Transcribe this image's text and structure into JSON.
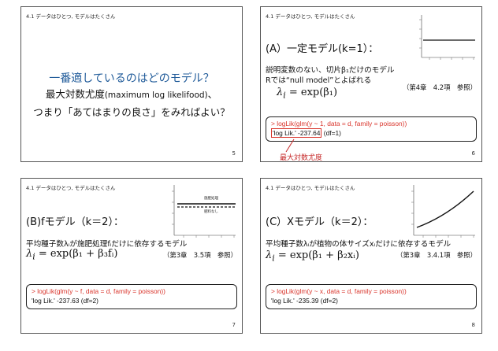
{
  "slides": [
    {
      "header": "4.1 データはひとつ, モデルはたくさん",
      "title": "一番適しているのはどのモデル？",
      "line1_main": "最大対数尤度",
      "line1_small": "(maximum log likelifood)",
      "line1_tail": "、",
      "line2": "つまり「あてはまりの良さ」をみればよい？",
      "page": "5"
    },
    {
      "header": "4.1 データはひとつ, モデルはたくさん",
      "model_title": "(A）一定モデル(k=1）：",
      "desc1": "説明変数のない、切片β₁だけのモデル",
      "desc2": "Rでは“null model”とよばれる",
      "ref": "（第4章　4.2項　参照）",
      "formula_lhs": "λ",
      "formula_sub": "i",
      "formula_rhs": " = exp(β₁)",
      "code": "> logLik(glm(y ~ 1, data = d, family = poisson))",
      "result_boxed": "'log Lik.' -237.64",
      "result_tail": " (df=1)",
      "annotation": "最大対数尤度",
      "page": "6"
    },
    {
      "header": "4.1 データはひとつ, モデルはたくさん",
      "model_title": "(B)fモデル（k＝2）：",
      "desc1": "平均種子数λᵢが施肥処理fᵢだけに依存するモデル",
      "ref": "（第3章　3.5項　参照）",
      "formula_lhs": "λ",
      "formula_sub": "i",
      "formula_rhs": " = exp(β₁ + β₃fᵢ)",
      "code": "> logLik(glm(y ~ f, data = d, family = poisson))",
      "result": "'log Lik.' -237.63 (df=2)",
      "legend_top": "施肥処理",
      "legend_bottom": "肥料なし",
      "page": "7"
    },
    {
      "header": "4.1 データはひとつ, モデルはたくさん",
      "model_title": "(C）Xモデル（k＝2）：",
      "desc1": "平均種子数λᵢが植物の体サイズxᵢだけに依存するモデル",
      "ref": "（第3章　3.4.1項　参照）",
      "formula_lhs": "λ",
      "formula_sub": "i",
      "formula_rhs": " = exp(β₁ + β₂xᵢ)",
      "code": "> logLik(glm(y ~ x, data = d, family = poisson))",
      "result": "'log Lik.' -235.39 (df=2)",
      "page": "8"
    }
  ],
  "colors": {
    "accent_blue": "#1f5a99",
    "code_red": "#d9342b",
    "annot_red": "#c62828"
  },
  "chart_data": [
    {
      "type": "line",
      "slide": "6",
      "description_values": "constant",
      "y_level": 0.5
    },
    {
      "type": "line",
      "slide": "7",
      "series_levels": [
        0.55,
        0.5
      ]
    },
    {
      "type": "line",
      "slide": "8",
      "shape": "increasing exponential"
    }
  ]
}
